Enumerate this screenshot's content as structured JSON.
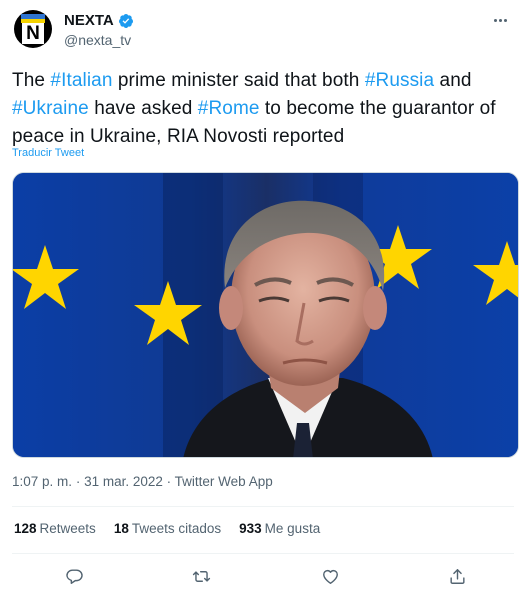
{
  "author": {
    "display_name": "NEXTA",
    "handle": "@nexta_tv",
    "avatar_logo": "N",
    "verified_icon": "verified-badge-icon"
  },
  "tweet": {
    "segments": [
      {
        "text": "The ",
        "hashtag": false
      },
      {
        "text": "#Italian",
        "hashtag": true
      },
      {
        "text": " prime minister said that both ",
        "hashtag": false
      },
      {
        "text": "#Russia",
        "hashtag": true
      },
      {
        "text": " and ",
        "hashtag": false
      },
      {
        "text": "#Ukraine",
        "hashtag": true
      },
      {
        "text": " have asked ",
        "hashtag": false
      },
      {
        "text": "#Rome",
        "hashtag": true
      },
      {
        "text": " to become the guarantor of peace in Ukraine, RIA Novosti reported",
        "hashtag": false
      }
    ],
    "translate_label": "Traducir Tweet"
  },
  "meta": {
    "time": "1:07 p. m.",
    "separator": "·",
    "date": "31 mar. 2022",
    "source": "Twitter Web App"
  },
  "stats": {
    "retweets_count": "128",
    "retweets_label": "Retweets",
    "quotes_count": "18",
    "quotes_label": "Tweets citados",
    "likes_count": "933",
    "likes_label": "Me gusta"
  },
  "actions": [
    "reply-icon",
    "retweet-icon",
    "like-icon",
    "share-icon"
  ],
  "colors": {
    "accent": "#1d9bf0",
    "text": "#0f1419",
    "muted": "#536471",
    "flag_blue": "#0c3c9e",
    "flag_star": "#ffd500"
  }
}
